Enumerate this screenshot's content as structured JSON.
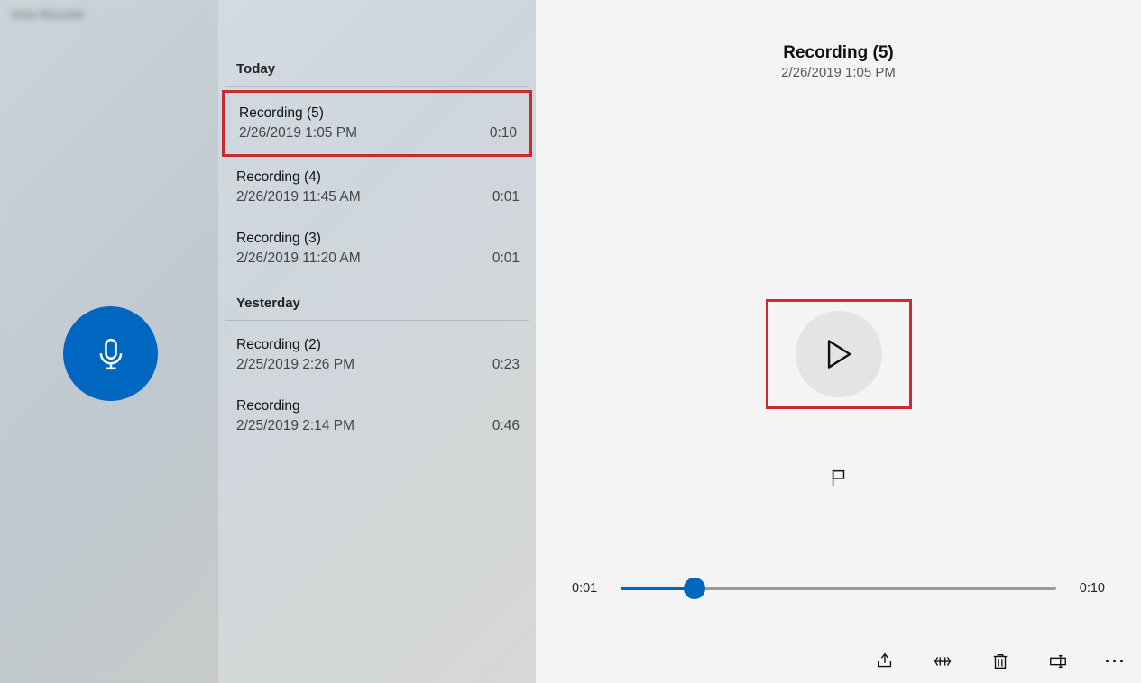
{
  "app_title": "Voice Recorder",
  "groups": [
    {
      "label": "Today",
      "items": [
        {
          "title": "Recording (5)",
          "subtitle": "2/26/2019 1:05 PM",
          "duration": "0:10",
          "selected": true
        },
        {
          "title": "Recording (4)",
          "subtitle": "2/26/2019 11:45 AM",
          "duration": "0:01",
          "selected": false
        },
        {
          "title": "Recording (3)",
          "subtitle": "2/26/2019 11:20 AM",
          "duration": "0:01",
          "selected": false
        }
      ]
    },
    {
      "label": "Yesterday",
      "items": [
        {
          "title": "Recording (2)",
          "subtitle": "2/25/2019 2:26 PM",
          "duration": "0:23",
          "selected": false
        },
        {
          "title": "Recording",
          "subtitle": "2/25/2019 2:14 PM",
          "duration": "0:46",
          "selected": false
        }
      ]
    }
  ],
  "playback": {
    "title": "Recording (5)",
    "subtitle": "2/26/2019 1:05 PM",
    "current_time": "0:01",
    "total_time": "0:10",
    "progress_percent": 17
  },
  "icons": {
    "record": "microphone-icon",
    "play": "play-icon",
    "flag": "flag-icon",
    "share": "share-icon",
    "trim": "trim-icon",
    "delete": "trash-icon",
    "rename": "rename-icon",
    "more": "more-icon",
    "minimize": "minimize-icon",
    "maximize": "maximize-icon",
    "close": "close-icon"
  },
  "colors": {
    "accent": "#0067c0",
    "highlight_border": "#cc2b2e"
  }
}
